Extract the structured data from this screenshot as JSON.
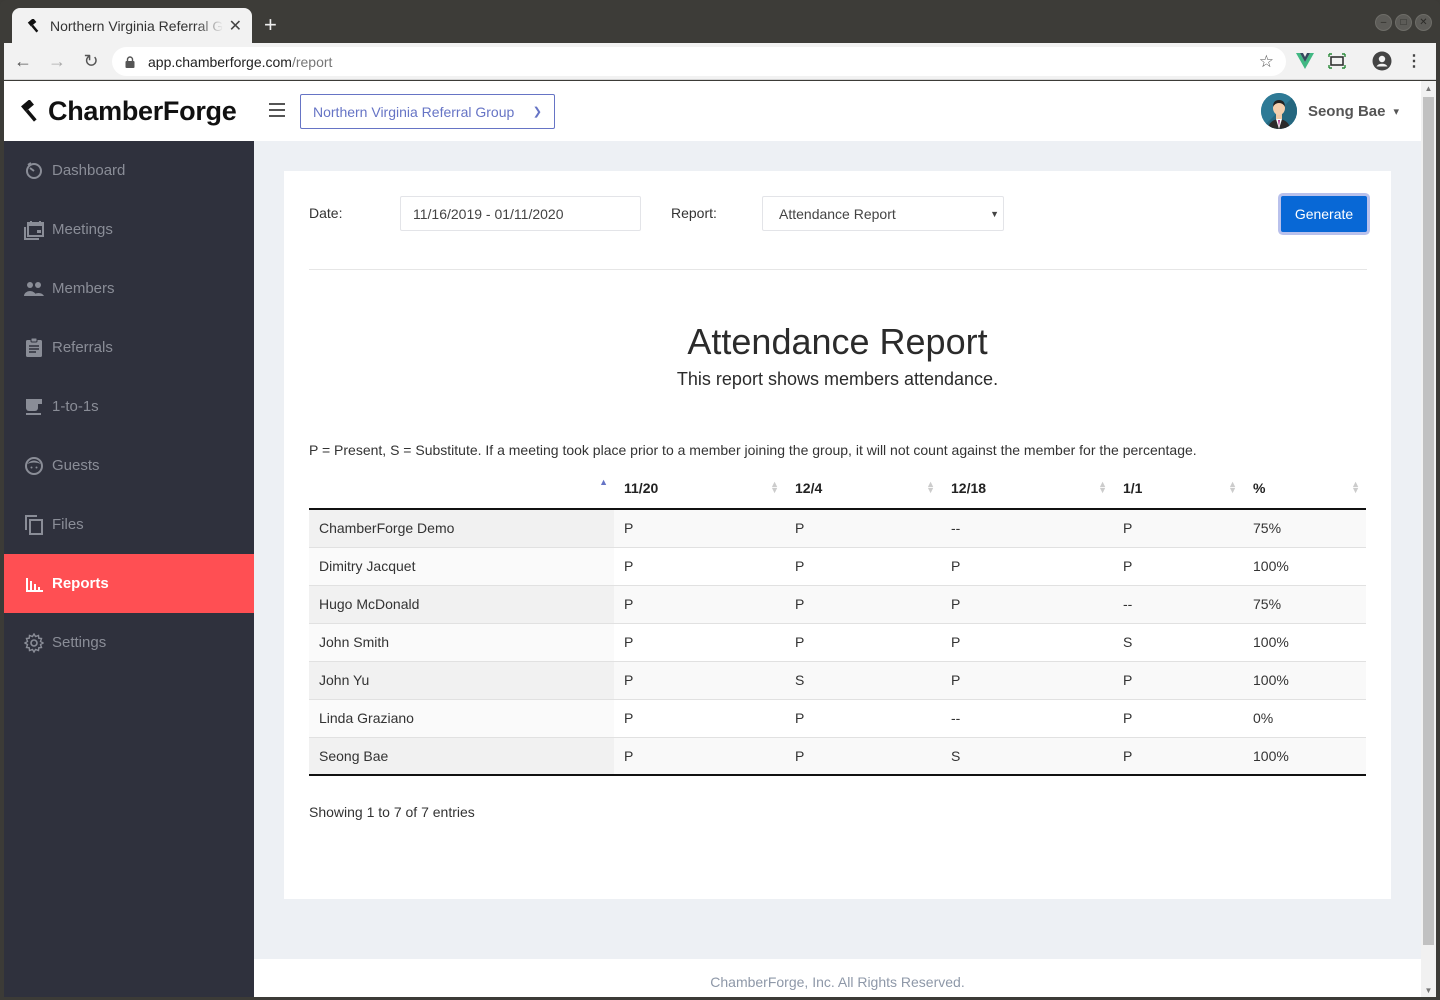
{
  "browser": {
    "tab_title": "Northern Virginia Referral Group",
    "url_host": "app.chamberforge.com",
    "url_path": "/report"
  },
  "app": {
    "brand": "ChamberForge",
    "group_selector": "Northern Virginia Referral Group",
    "user_name": "Seong Bae"
  },
  "sidebar": {
    "items": [
      {
        "label": "Dashboard",
        "icon": "dashboard-icon",
        "active": false
      },
      {
        "label": "Meetings",
        "icon": "calendar-icon",
        "active": false
      },
      {
        "label": "Members",
        "icon": "people-icon",
        "active": false
      },
      {
        "label": "Referrals",
        "icon": "clipboard-icon",
        "active": false
      },
      {
        "label": "1-to-1s",
        "icon": "coffee-icon",
        "active": false
      },
      {
        "label": "Guests",
        "icon": "face-icon",
        "active": false
      },
      {
        "label": "Files",
        "icon": "files-icon",
        "active": false
      },
      {
        "label": "Reports",
        "icon": "bar-chart-icon",
        "active": true
      },
      {
        "label": "Settings",
        "icon": "gear-icon",
        "active": false
      }
    ]
  },
  "filters": {
    "date_label": "Date:",
    "date_value": "11/16/2019 - 01/11/2020",
    "report_label": "Report:",
    "report_value": "Attendance Report",
    "generate_label": "Generate"
  },
  "report": {
    "title": "Attendance Report",
    "subtitle": "This report shows members attendance.",
    "legend": "P = Present, S = Substitute. If a meeting took place prior to a member joining the group, it will not count against the member for the percentage.",
    "columns": [
      "",
      "11/20",
      "12/4",
      "12/18",
      "1/1",
      "%"
    ],
    "rows": [
      [
        "ChamberForge Demo",
        "P",
        "P",
        "--",
        "P",
        "75%"
      ],
      [
        "Dimitry Jacquet",
        "P",
        "P",
        "P",
        "P",
        "100%"
      ],
      [
        "Hugo McDonald",
        "P",
        "P",
        "P",
        "--",
        "75%"
      ],
      [
        "John Smith",
        "P",
        "P",
        "P",
        "S",
        "100%"
      ],
      [
        "John Yu",
        "P",
        "S",
        "P",
        "P",
        "100%"
      ],
      [
        "Linda Graziano",
        "P",
        "P",
        "--",
        "P",
        "0%"
      ],
      [
        "Seong Bae",
        "P",
        "P",
        "S",
        "P",
        "100%"
      ]
    ],
    "info": "Showing 1 to 7 of 7 entries"
  },
  "footer": "ChamberForge, Inc. All Rights Reserved."
}
